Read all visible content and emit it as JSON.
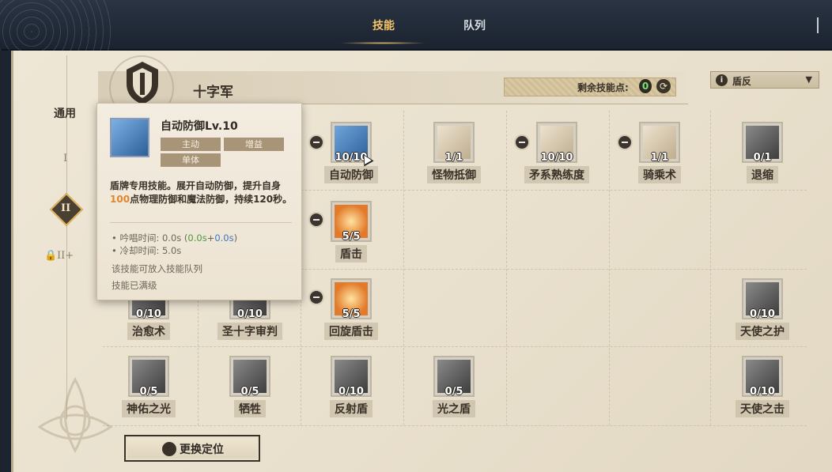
{
  "tabs": [
    {
      "label": "技能",
      "active": true
    },
    {
      "label": "队列",
      "active": false
    }
  ],
  "header": {
    "class_name": "十字军",
    "points_label": "剩余技能点:",
    "points_value": "0",
    "dropdown_label": "盾反"
  },
  "tiers": {
    "general": "通用",
    "tier1": "I",
    "tier2": "II",
    "tier3": "II+"
  },
  "tooltip": {
    "title": "自动防御Lv.10",
    "tags": [
      "主动",
      "增益",
      "单体"
    ],
    "desc_pre": "盾牌专用技能。展开自动防御，提升自身",
    "desc_highlight": "100",
    "desc_post": "点物理防御和魔法防御，持续120秒。",
    "cast_label": "• 吟唱时间: 0.0s",
    "cast_detail_open": "(",
    "cast_detail_green": "0.0s",
    "cast_detail_plus": "+",
    "cast_detail_blue": "0.0s",
    "cast_detail_close": ")",
    "cooldown": "• 冷却时间: 5.0s",
    "note1": "该技能可放入技能队列",
    "note2": "技能已满级"
  },
  "skills": [
    {
      "name": "自动防御",
      "level": "10/10",
      "icon": "shield-gear-icon",
      "color": "#3d6fa8"
    },
    {
      "name": "怪物抵御",
      "level": "1/1",
      "icon": "shield-emblem-icon",
      "color": "#c9b9a0"
    },
    {
      "name": "矛系熟练度",
      "level": "10/10",
      "icon": "spear-icon",
      "color": "#c9b9a0"
    },
    {
      "name": "骑乘术",
      "level": "1/1",
      "icon": "mount-icon",
      "color": "#c9b9a0"
    },
    {
      "name": "退缩",
      "level": "0/1",
      "icon": "retreat-icon",
      "color": "#555"
    },
    {
      "name": "盾击",
      "level": "5/5",
      "icon": "shield-bash-icon",
      "color": "#e0702a"
    },
    {
      "name": "治愈术",
      "level": "0/10",
      "icon": "heal-icon",
      "color": "#555"
    },
    {
      "name": "圣十字审判",
      "level": "0/10",
      "icon": "holy-cross-icon",
      "color": "#555"
    },
    {
      "name": "回旋盾击",
      "level": "5/5",
      "icon": "spin-shield-icon",
      "color": "#e0702a"
    },
    {
      "name": "天使之护",
      "level": "0/10",
      "icon": "angel-guard-icon",
      "color": "#555"
    },
    {
      "name": "神佑之光",
      "level": "0/5",
      "icon": "blessing-light-icon",
      "color": "#555"
    },
    {
      "name": "牺牲",
      "level": "0/5",
      "icon": "sacrifice-icon",
      "color": "#555"
    },
    {
      "name": "反射盾",
      "level": "0/10",
      "icon": "reflect-shield-icon",
      "color": "#555"
    },
    {
      "name": "光之盾",
      "level": "0/5",
      "icon": "light-shield-icon",
      "color": "#555"
    },
    {
      "name": "天使之击",
      "level": "0/10",
      "icon": "angel-strike-icon",
      "color": "#555"
    }
  ],
  "bottom_button": "更换定位"
}
